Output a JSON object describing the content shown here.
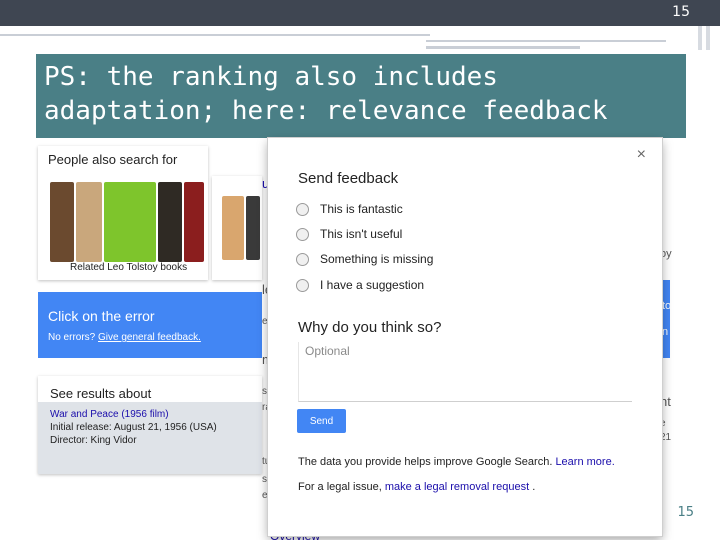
{
  "slide": {
    "page_number_top": "15",
    "title": "PS: the ranking also includes adaptation; here: relevance feedback",
    "page_number_bottom": "15"
  },
  "people_also_search": {
    "heading": "People also search for",
    "caption": "Related Leo Tolstoy books",
    "book_colors": [
      "#6b4a2f",
      "#7ec52c",
      "#2f2a24",
      "#8b1e1e",
      "#d9a66e",
      "#3a3a3a",
      "#1e4b7a"
    ]
  },
  "error_panel": {
    "title": "Click on the error",
    "sub_prefix": "No errors?",
    "sub_link": "Give general feedback."
  },
  "results_panel": {
    "heading": "See results about",
    "link": "War and Peace (1956 film)",
    "line1": "Initial release: August 21, 1956 (USA)",
    "line2": "Director: King Vidor"
  },
  "feedback_dialog": {
    "title": "Send feedback",
    "close_glyph": "×",
    "options": [
      "This is fantastic",
      "This isn't useful",
      "Something is missing",
      "I have a suggestion"
    ],
    "question": "Why do you think so?",
    "placeholder": "Optional",
    "send_label": "Send",
    "note1_text": "The data you provide helps improve Google Search.",
    "note1_link": "Learn more.",
    "note2_text": "For a legal issue,",
    "note2_link": "make a legal removal request",
    "note2_end": "."
  },
  "bleed_text": {
    "left_fragments": [
      "us",
      "le",
      "ex",
      "m",
      "s",
      "ra",
      "tu",
      "s",
      "e"
    ],
    "right_fragments": [
      "oy",
      "to",
      "n",
      "nt",
      "e",
      "21"
    ],
    "bottom_fragment": "Overview"
  },
  "colors": {
    "title_bg": "#4a7f86",
    "google_blue": "#4286f4",
    "topbar": "#3f4652"
  }
}
